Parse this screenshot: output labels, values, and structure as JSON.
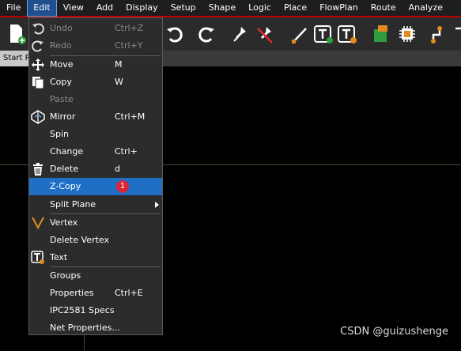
{
  "menubar": [
    "File",
    "Edit",
    "View",
    "Add",
    "Display",
    "Setup",
    "Shape",
    "Logic",
    "Place",
    "FlowPlan",
    "Route",
    "Analyze"
  ],
  "tab_label": "Start Page",
  "edit_menu": {
    "undo": {
      "label": "Undo",
      "shortcut": "Ctrl+Z"
    },
    "redo": {
      "label": "Redo",
      "shortcut": "Ctrl+Y"
    },
    "move": {
      "label": "Move",
      "shortcut": "M"
    },
    "copy": {
      "label": "Copy",
      "shortcut": "W"
    },
    "paste": {
      "label": "Paste"
    },
    "mirror": {
      "label": "Mirror",
      "shortcut": "Ctrl+M"
    },
    "spin": {
      "label": "Spin"
    },
    "change": {
      "label": "Change",
      "shortcut": "Ctrl+"
    },
    "delete": {
      "label": "Delete",
      "shortcut": "d"
    },
    "zcopy": {
      "label": "Z-Copy",
      "badge": "1"
    },
    "split_plane": {
      "label": "Split Plane"
    },
    "vertex": {
      "label": "Vertex"
    },
    "delete_vertex": {
      "label": "Delete Vertex"
    },
    "text": {
      "label": "Text"
    },
    "groups": {
      "label": "Groups"
    },
    "properties": {
      "label": "Properties",
      "shortcut": "Ctrl+E"
    },
    "ipc2581": {
      "label": "IPC2581 Specs"
    },
    "net_properties": {
      "label": "Net Properties..."
    }
  },
  "watermark": "CSDN @guizushenge",
  "colors": {
    "highlight": "#1f6fc7",
    "menubar_border": "#c00000",
    "badge": "#d9263a"
  }
}
